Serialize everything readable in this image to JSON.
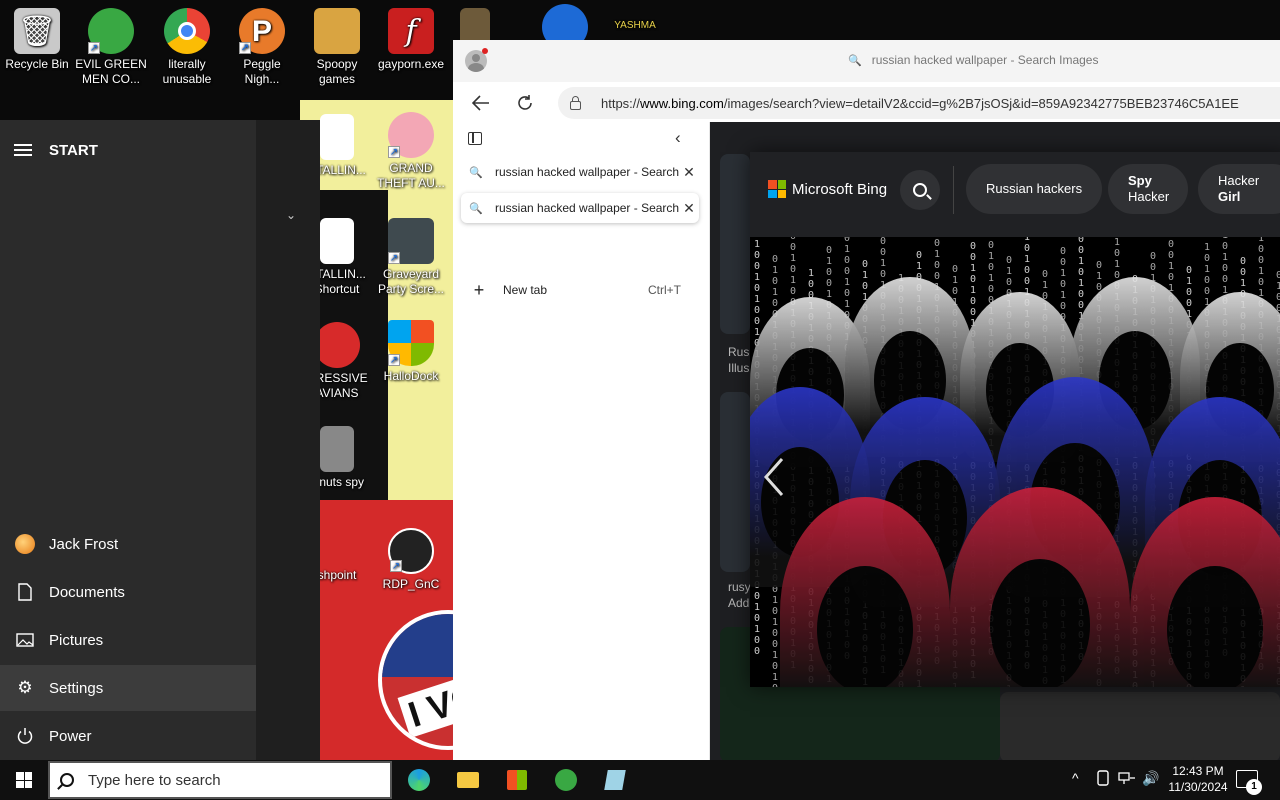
{
  "desktop": {
    "icons_top": [
      {
        "label": "Recycle Bin",
        "icon": "recycle-bin-icon"
      },
      {
        "label": "EVIL GREEN MEN CO...",
        "icon": "green-men-icon"
      },
      {
        "label": "literally unusable",
        "icon": "chrome-icon"
      },
      {
        "label": "Peggle Nigh...",
        "icon": "peggle-icon"
      },
      {
        "label": "Spoopy games",
        "icon": "folder-icon"
      },
      {
        "label": "gayporn.exe",
        "icon": "flash-icon"
      }
    ],
    "icons_col5": [
      {
        "label": "STALLIN...",
        "icon": "document-icon"
      },
      {
        "label": "STALLIN... Shortcut",
        "icon": "document-icon"
      },
      {
        "label": "GRESSIVE AVIANS",
        "icon": "angry-bird-icon"
      },
      {
        "label": "z nuts spy",
        "icon": "windows-stack-icon"
      },
      {
        "label": "shpoint",
        "icon": "app-icon"
      }
    ],
    "icons_col6": [
      {
        "label": "GRAND THEFT AU...",
        "icon": "anime-girl-icon"
      },
      {
        "label": "Graveyard Party Scre...",
        "icon": "graveyard-icon"
      },
      {
        "label": "HalloDock",
        "icon": "windows-shield-icon"
      },
      {
        "label": "RDP_GnC",
        "icon": "rdp-icon"
      }
    ],
    "wallpaper_text": "I VO"
  },
  "start_menu": {
    "title": "START",
    "items": [
      {
        "label": "Jack Frost",
        "icon": "user-avatar-icon"
      },
      {
        "label": "Documents",
        "icon": "document-icon"
      },
      {
        "label": "Pictures",
        "icon": "pictures-icon"
      },
      {
        "label": "Settings",
        "icon": "gear-icon"
      },
      {
        "label": "Power",
        "icon": "power-icon"
      }
    ]
  },
  "browser": {
    "window_title": "russian hacked wallpaper - Search Images",
    "url_prefix": "https://",
    "url_host": "www.bing.com",
    "url_rest": "/images/search?view=detailV2&ccid=g%2B7jsOSj&id=859A92342775BEB23746C5A1EE",
    "tabs": [
      {
        "title": "russian hacked wallpaper - Search Images",
        "active": false
      },
      {
        "title": "russian hacked wallpaper - Search Images",
        "active": true
      }
    ],
    "new_tab_label": "New tab",
    "new_tab_shortcut": "Ctrl+T"
  },
  "bing": {
    "brand": "Microsoft Bing",
    "chips": [
      {
        "line1": "Russian hackers",
        "line2": ""
      },
      {
        "line1": "Spy",
        "line2": "Hacker"
      },
      {
        "line1": "Hacker",
        "line2": "Girl"
      }
    ],
    "bg_captions": [
      "Rus",
      "Illus",
      "rusy",
      "Add"
    ]
  },
  "taskbar": {
    "search_placeholder": "Type here to search",
    "time": "12:43 PM",
    "date": "11/30/2024",
    "notification_count": "1"
  },
  "colors": {
    "accent_blue": "#1a73e8",
    "flag_white": "#e8e8e8",
    "flag_blue": "#2b36c8",
    "flag_red": "#c8203a"
  }
}
